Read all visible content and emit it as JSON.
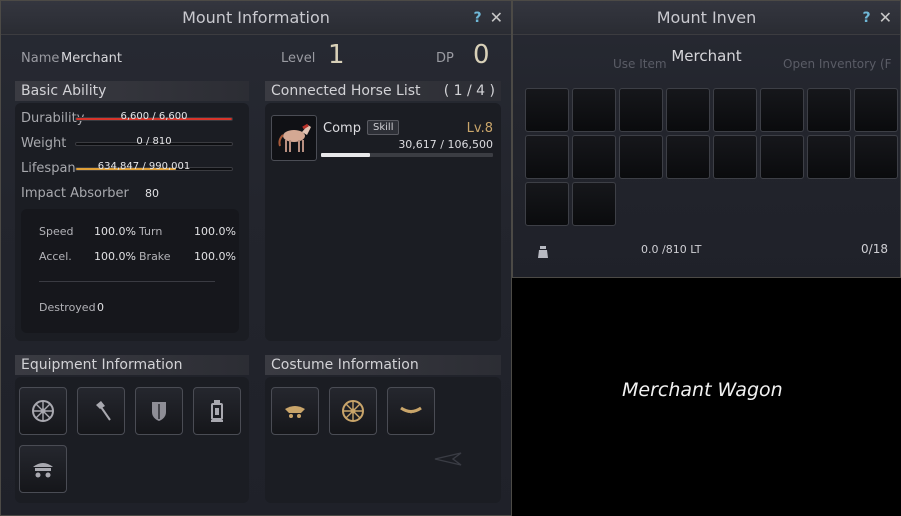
{
  "mount_info": {
    "title": "Mount Information",
    "help_icon": "?",
    "close_icon": "✕",
    "name_label": "Name",
    "name_value": "Merchant",
    "level_label": "Level",
    "level_value": "1",
    "dp_label": "DP",
    "dp_value": "0",
    "basic_ability": {
      "title": "Basic Ability",
      "durability": {
        "label": "Durability",
        "text": "6,600 / 6,600",
        "fraction": 1.0,
        "color": "#d8342a"
      },
      "weight": {
        "label": "Weight",
        "text": "0 / 810",
        "fraction": 0.0
      },
      "lifespan": {
        "label": "Lifespan",
        "text": "634,847 / 990,001",
        "fraction": 0.641,
        "color": "#e0a038"
      },
      "impact_label": "Impact Absorber",
      "impact_value": "80",
      "speed_label": "Speed",
      "speed_value": "100.0%",
      "turn_label": "Turn",
      "turn_value": "100.0%",
      "accel_label": "Accel.",
      "accel_value": "100.0%",
      "brake_label": "Brake",
      "brake_value": "100.0%",
      "destroyed_label": "Destroyed",
      "destroyed_value": "0"
    },
    "horse_list": {
      "title": "Connected Horse List",
      "count": "( 1 / 4 )",
      "items": [
        {
          "name": "Comp",
          "tag": "Skill",
          "level": "Lv.8",
          "exp_text": "30,617 / 106,500",
          "exp_fraction": 0.287
        }
      ]
    },
    "equipment": {
      "title": "Equipment Information",
      "slots": [
        "wheel-icon",
        "axe-icon",
        "shield-icon",
        "lantern-icon",
        "canopy-icon"
      ]
    },
    "costume": {
      "title": "Costume Information",
      "slots": [
        "canopy-icon",
        "wheel-icon",
        "ornament-icon"
      ]
    }
  },
  "mount_inven": {
    "title": "Mount Inven",
    "help_icon": "?",
    "close_icon": "✕",
    "name": "Merchant",
    "bg_left_text": "Use Item",
    "bg_right_text": "Open Inventory (F",
    "weight_text": "0.0 /810 LT",
    "slot_count_text": "0/18",
    "slots": 18
  },
  "caption": "Merchant Wagon",
  "colors": {
    "gold": "#c9a56a",
    "accent_blue": "#6fb7d6"
  }
}
